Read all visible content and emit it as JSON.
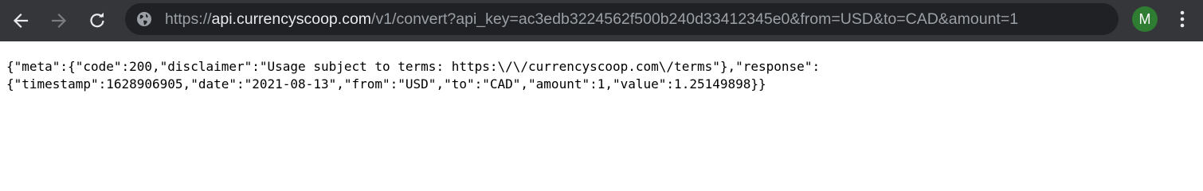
{
  "browser": {
    "url_scheme": "https://",
    "url_host": "api.currencyscoop.com",
    "url_path": "/v1/convert?api_key=ac3edb3224562f500b240d33412345e0&from=USD&to=CAD&amount=1",
    "profile_initial": "M",
    "profile_color": "#2e7d32",
    "icons": {
      "back": "back-arrow-icon",
      "forward": "forward-arrow-icon",
      "reload": "reload-icon",
      "site": "globe-icon",
      "menu": "kebab-menu-icon"
    }
  },
  "page": {
    "line1": "{\"meta\":{\"code\":200,\"disclaimer\":\"Usage subject to terms: https:\\/\\/currencyscoop.com\\/terms\"},\"response\":",
    "line2": "{\"timestamp\":1628906905,\"date\":\"2021-08-13\",\"from\":\"USD\",\"to\":\"CAD\",\"amount\":1,\"value\":1.25149898}}"
  }
}
